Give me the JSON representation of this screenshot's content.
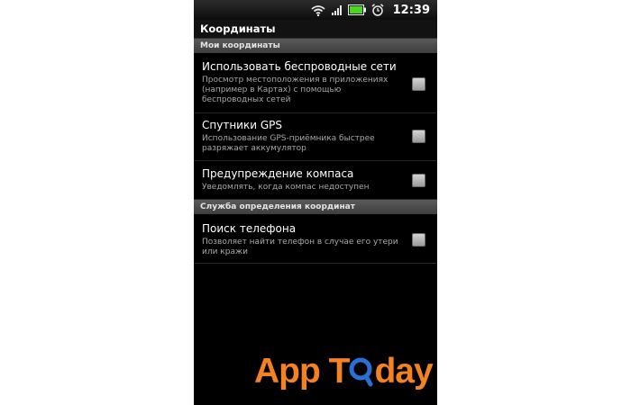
{
  "status_bar": {
    "time": "12:39",
    "icons": [
      "wifi-icon",
      "signal-icon",
      "battery-icon",
      "alarm-icon"
    ]
  },
  "screen": {
    "title": "Координаты"
  },
  "sections": [
    {
      "header": "Мои координаты",
      "items": [
        {
          "title": "Использовать беспроводные сети",
          "summary": "Просмотр местоположения в приложениях (например в Картах) с помощью беспроводных сетей",
          "checked": false
        },
        {
          "title": "Спутники GPS",
          "summary": "Использование GPS-приёмника быстрее разряжает аккумулятор",
          "checked": false
        },
        {
          "title": "Предупреждение компаса",
          "summary": "Уведомлять, когда компас недоступен",
          "checked": false
        }
      ]
    },
    {
      "header": "Служба определения координат",
      "items": [
        {
          "title": "Поиск телефона",
          "summary": "Позволяет найти телефон в случае его утери или кражи",
          "checked": false
        }
      ]
    }
  ],
  "watermark": {
    "text_before": "App T",
    "text_after": "day",
    "color": "#f58220",
    "lens_color": "#2a6fd6"
  }
}
